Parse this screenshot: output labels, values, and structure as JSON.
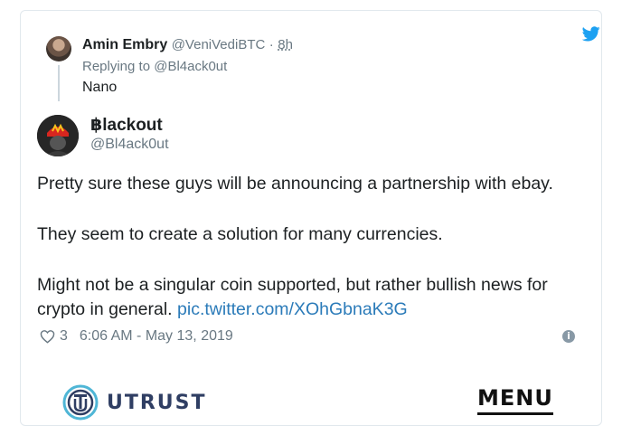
{
  "reply_tweet": {
    "author_name": "Amin Embry",
    "author_handle": "@VeniVediBTC",
    "separator": "·",
    "time": "8h",
    "replying_to": "Replying to @Bl4ack0ut",
    "text": "Nano"
  },
  "main_tweet": {
    "author_name": "฿lackout",
    "author_handle": "@Bl4ack0ut",
    "paragraph_1": "Pretty sure these guys will be announcing a partnership with ebay.",
    "paragraph_2": "They seem to create a solution for many currencies.",
    "paragraph_3_line_1": "Might not be a singular coin supported,  but rather bullish news for",
    "paragraph_3_line_2": "crypto in general.",
    "link_text": "pic.twitter.com/XOhGbnaK3G",
    "like_count": "3",
    "timestamp": "6:06 AM - May 13, 2019"
  },
  "footer": {
    "brand_name": "UTRUST",
    "menu_label": "MENU"
  },
  "icons": {
    "twitter": "twitter-bird-icon",
    "heart": "heart-icon",
    "info": "info-icon",
    "brand": "utrust-logo-icon"
  },
  "colors": {
    "twitter_blue": "#1da1f2",
    "link_blue": "#2b7bb9",
    "muted_gray": "#697882",
    "text_dark": "#1c2022",
    "utrust_navy": "#2f3e63",
    "utrust_teal": "#4fb6d6"
  }
}
